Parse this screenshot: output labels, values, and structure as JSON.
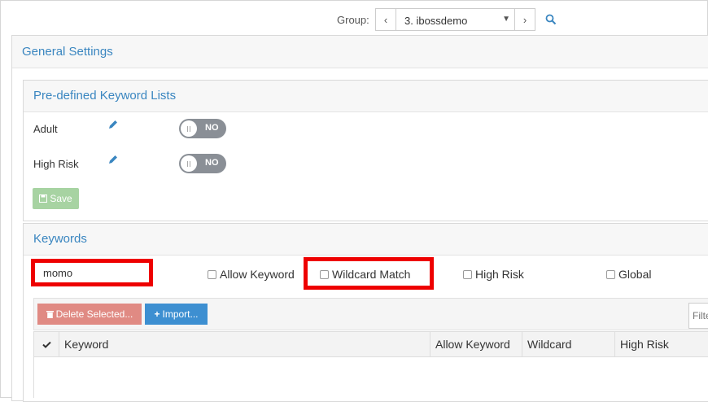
{
  "group": {
    "label": "Group:",
    "selected": "3. ibossdemo",
    "prev_glyph": "‹",
    "next_glyph": "›",
    "caret_glyph": "▼"
  },
  "general": {
    "title": "General Settings"
  },
  "predefined": {
    "title": "Pre-defined Keyword Lists",
    "items": [
      {
        "label": "Adult",
        "toggle": "NO"
      },
      {
        "label": "High Risk",
        "toggle": "NO"
      }
    ],
    "save_label": "Save"
  },
  "keywords": {
    "title": "Keywords",
    "input_value": "momo",
    "checkboxes": {
      "allow": "Allow Keyword",
      "wildcard": "Wildcard Match",
      "high_risk": "High Risk",
      "global": "Global"
    },
    "delete_label": "Delete Selected...",
    "import_label": "Import...",
    "filter_placeholder": "Filter",
    "columns": [
      "Keyword",
      "Allow Keyword",
      "Wildcard",
      "High Risk"
    ]
  },
  "colors": {
    "accent": "#3a86c0",
    "highlight": "#ee0000",
    "save": "#a7d3a2",
    "delete": "#e08a83",
    "import": "#3d8fd1",
    "toggle_off": "#8a8f96"
  }
}
